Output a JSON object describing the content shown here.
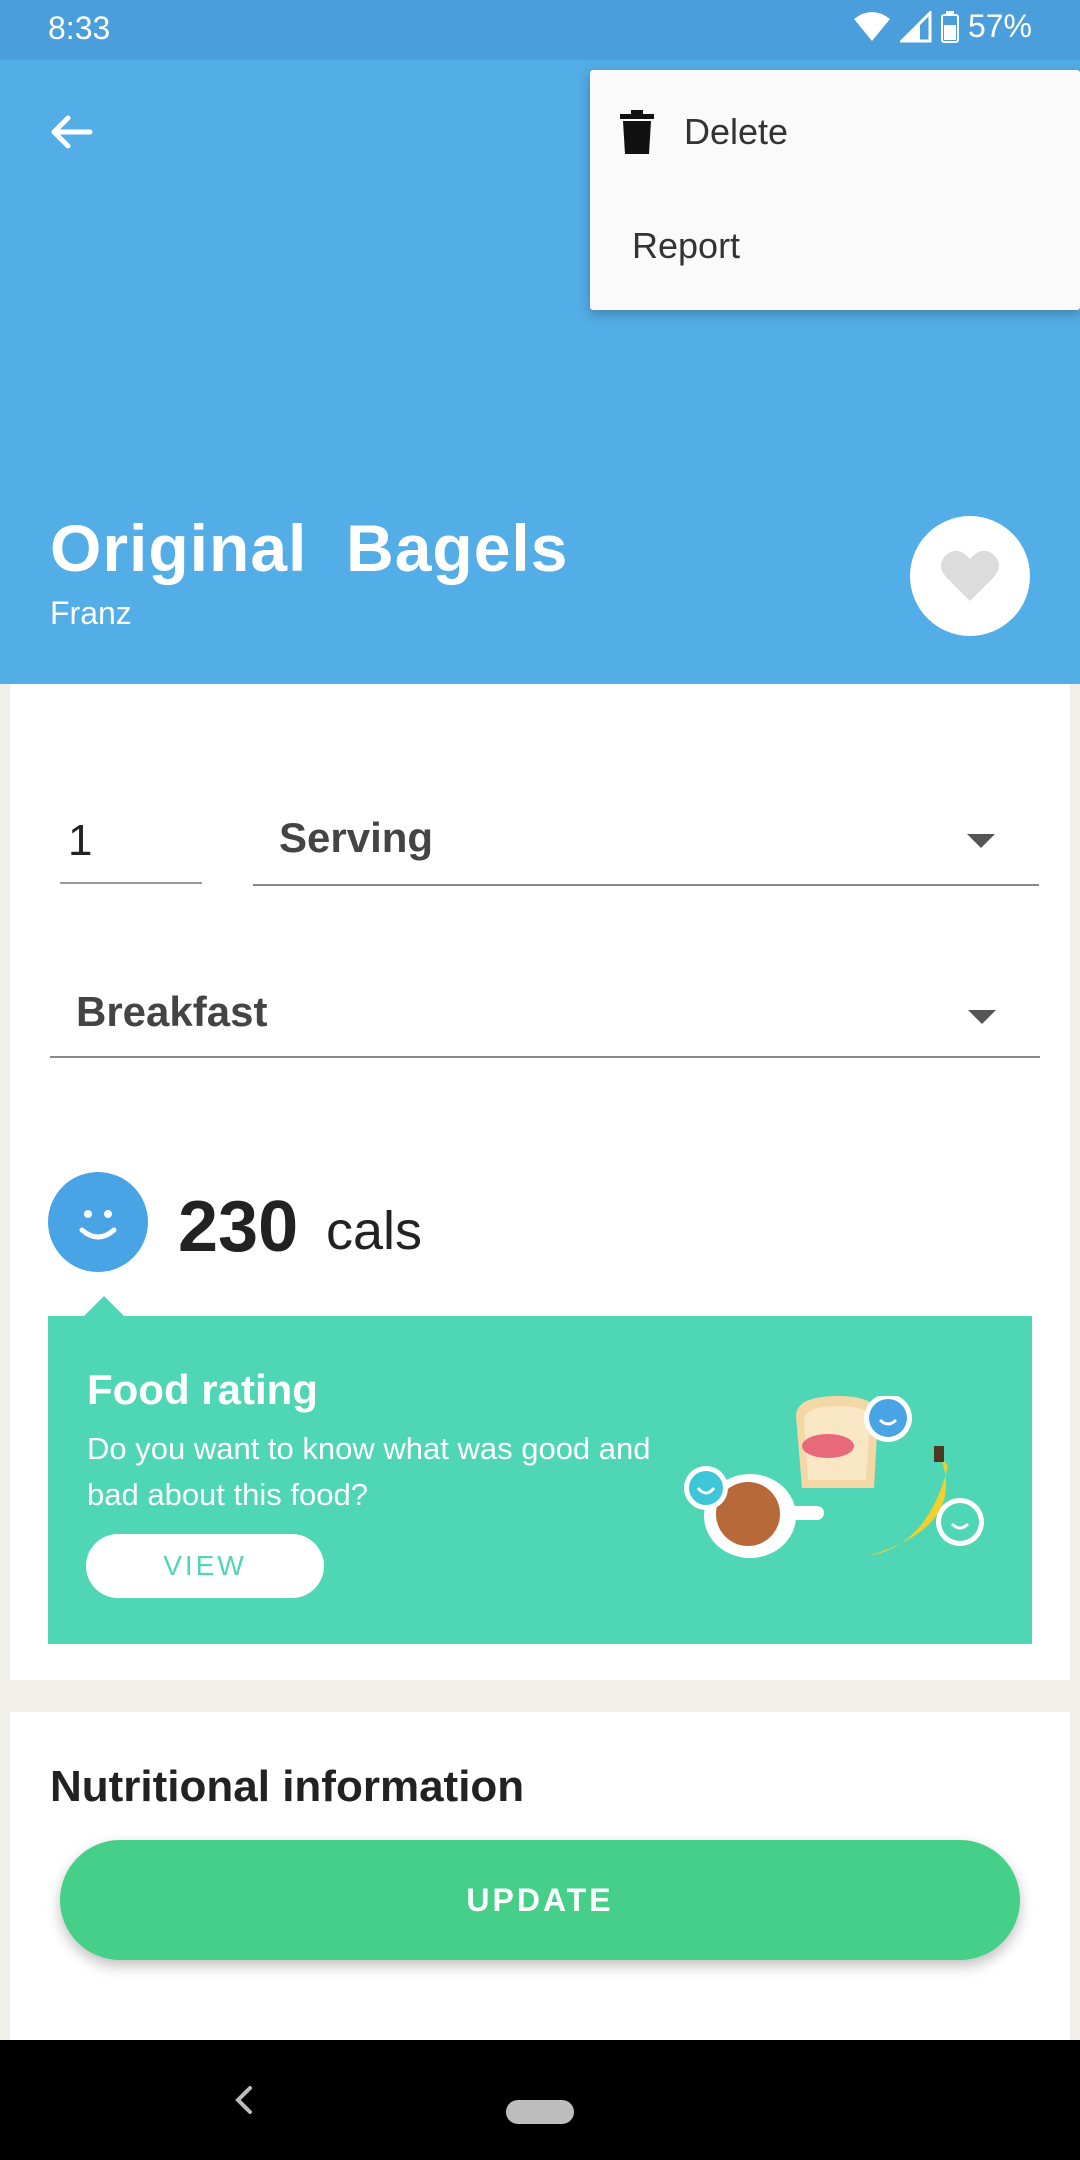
{
  "status_bar": {
    "time": "8:33",
    "battery": "57%",
    "icons": [
      "wifi-icon",
      "signal-icon",
      "battery-icon"
    ]
  },
  "header": {
    "back_icon": "arrow-left-icon",
    "title": "Original  Bagels",
    "brand": "Franz",
    "favorite_icon": "heart-icon",
    "background": "#53ade6"
  },
  "menu": {
    "items": [
      {
        "label": "Delete",
        "icon": "trash-icon"
      },
      {
        "label": "Report"
      }
    ]
  },
  "form": {
    "quantity": "1",
    "unit": "Serving",
    "meal": "Breakfast"
  },
  "calories": {
    "value": "230",
    "unit": "cals",
    "icon": "smiley-icon"
  },
  "food_rating": {
    "title": "Food rating",
    "text": "Do you want to know what was good and bad about this food?",
    "view_label": "VIEW",
    "background": "#4fd6b5"
  },
  "nutrition": {
    "title": "Nutritional information"
  },
  "update_button": {
    "label": "UPDATE",
    "color": "#45cf89"
  }
}
